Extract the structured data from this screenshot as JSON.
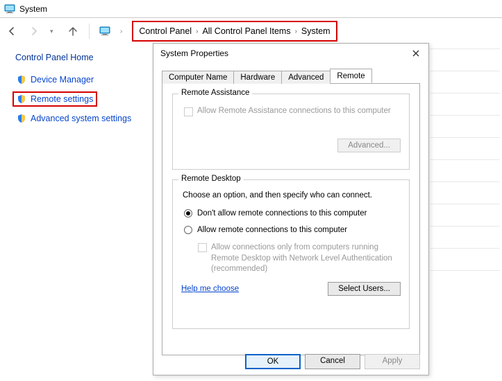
{
  "window": {
    "title": "System"
  },
  "breadcrumb": {
    "items": [
      "Control Panel",
      "All Control Panel Items",
      "System"
    ]
  },
  "sidebar": {
    "home": "Control Panel Home",
    "items": [
      {
        "label": "Device Manager"
      },
      {
        "label": "Remote settings"
      },
      {
        "label": "Advanced system settings"
      }
    ]
  },
  "dialog": {
    "title": "System Properties",
    "tabs": [
      "Computer Name",
      "Hardware",
      "Advanced",
      "Remote"
    ],
    "active_tab": "Remote",
    "remote_assistance": {
      "legend": "Remote Assistance",
      "allow_label": "Allow Remote Assistance connections to this computer",
      "advanced_btn": "Advanced..."
    },
    "remote_desktop": {
      "legend": "Remote Desktop",
      "intro": "Choose an option, and then specify who can connect.",
      "opt_deny": "Don't allow remote connections to this computer",
      "opt_allow": "Allow remote connections to this computer",
      "nla_label": "Allow connections only from computers running Remote Desktop with Network Level Authentication (recommended)",
      "help": "Help me choose",
      "select_users_btn": "Select Users..."
    },
    "buttons": {
      "ok": "OK",
      "cancel": "Cancel",
      "apply": "Apply"
    }
  }
}
